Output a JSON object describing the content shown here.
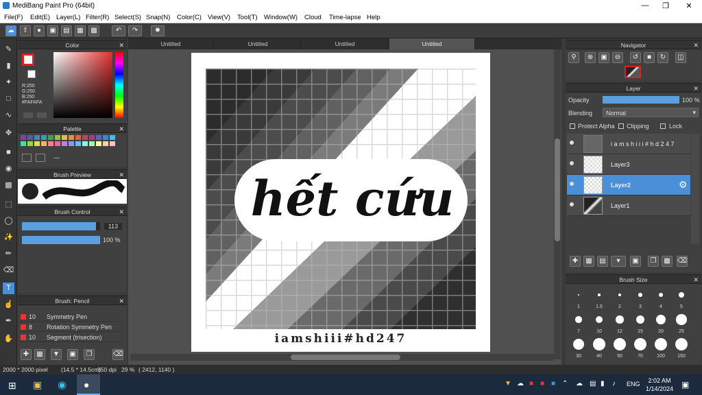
{
  "window": {
    "title": "MediBang Paint Pro (64bit)"
  },
  "menu": [
    "File(F)",
    "Edit(E)",
    "Layer(L)",
    "Filter(R)",
    "Select(S)",
    "Snap(N)",
    "Color(C)",
    "View(V)",
    "Tool(T)",
    "Window(W)",
    "Cloud",
    "Time-lapse",
    "Help"
  ],
  "tabs": [
    "Untitled",
    "Untitled",
    "Untitled",
    "Untitled"
  ],
  "color_panel": {
    "title": "Color",
    "r": "R:250",
    "g": "G:250",
    "b": "B:250",
    "hex": "#FAFAFA"
  },
  "palette_panel": {
    "title": "Palette",
    "more": "---"
  },
  "brush_preview": {
    "title": "Brush Preview"
  },
  "brush_control": {
    "title": "Brush Control",
    "size": "113",
    "opacity": "100 %",
    "size_fraction": 0.95,
    "opacity_fraction": 1.0
  },
  "brush_list": {
    "title": "Brush: Pencil",
    "items": [
      {
        "num": "10",
        "name": "Symmetry Pen"
      },
      {
        "num": "8",
        "name": "Rotation Symmetry Pen"
      },
      {
        "num": "10",
        "name": "Segment (trisection)"
      }
    ]
  },
  "navigator": {
    "title": "Navigator"
  },
  "layer_panel": {
    "title": "Layer",
    "opacity_label": "Opacity",
    "opacity_value": "100 %",
    "opacity_fraction": 1.0,
    "blending_label": "Blending",
    "blending_value": "Normal",
    "protect_alpha": "Protect Alpha",
    "clipping": "Clipping",
    "lock": "Lock",
    "layers": [
      {
        "name": "i a m s h i i i # h d 2 4 7",
        "selected": false
      },
      {
        "name": "Layer3",
        "selected": false
      },
      {
        "name": "Layer2",
        "selected": true
      },
      {
        "name": "Layer1",
        "selected": false
      }
    ]
  },
  "brush_size": {
    "title": "Brush Size",
    "sizes": [
      "1",
      "1.5",
      "2",
      "3",
      "4",
      "5",
      "7",
      "10",
      "12",
      "15",
      "20",
      "25",
      "30",
      "40",
      "50",
      "70",
      "100",
      "150"
    ]
  },
  "artwork": {
    "title_text": "hết cứu",
    "caption": "iamshiii#hd247"
  },
  "status": {
    "dimensions": "2000 * 2000 pixel",
    "physical": "(14.5 * 14.5cm)",
    "dpi": "350 dpi",
    "zoom": "29 %",
    "coords": "( 2412, 1140 )"
  },
  "taskbar": {
    "time": "2:02 AM",
    "date": "1/14/2024",
    "lang": "ENG"
  },
  "colors": {
    "accent": "#4a90d9",
    "panel": "#404040",
    "canvas_bg": "#505050"
  }
}
